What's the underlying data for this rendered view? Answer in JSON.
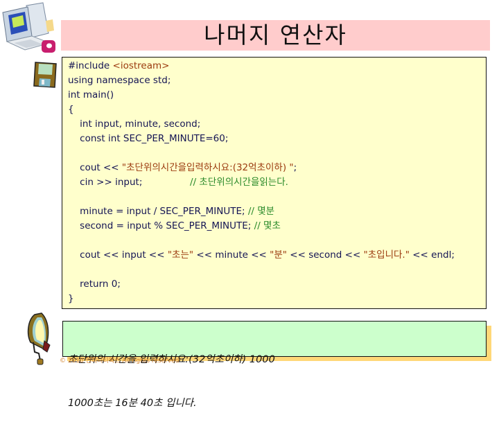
{
  "slide": {
    "title": "나머지 연산자",
    "icons": {
      "top_left": "computer-icon",
      "code_marker": "floppy-disk-icon",
      "output_marker": "monitor-lamp-icon"
    },
    "colors": {
      "title_bg": "#FFCCCC",
      "code_bg": "#FFFFCC",
      "output_bg": "#CCFFCC",
      "output_shadow": "#FFD878",
      "code_text": "#141454",
      "string_text": "#9b3a0f",
      "comment_text": "#2a8a2a"
    }
  },
  "code": {
    "lines": [
      {
        "parts": [
          {
            "t": "#include ",
            "k": "plain"
          },
          {
            "t": "<iostream>",
            "k": "inc"
          }
        ]
      },
      {
        "parts": [
          {
            "t": "using namespace std;",
            "k": "plain"
          }
        ]
      },
      {
        "parts": [
          {
            "t": "int main()",
            "k": "plain"
          }
        ]
      },
      {
        "parts": [
          {
            "t": "{",
            "k": "plain"
          }
        ]
      },
      {
        "parts": [
          {
            "t": "    int input, minute, second;",
            "k": "plain"
          }
        ]
      },
      {
        "parts": [
          {
            "t": "    const int SEC_PER_MINUTE=60;",
            "k": "plain"
          }
        ]
      },
      {
        "parts": []
      },
      {
        "parts": [
          {
            "t": "    cout << ",
            "k": "plain"
          },
          {
            "t": "\"초단위의시간을입력하시요:(32억초이하) \"",
            "k": "str"
          },
          {
            "t": ";",
            "k": "plain"
          }
        ]
      },
      {
        "parts": [
          {
            "t": "    cin >> input;                ",
            "k": "plain"
          },
          {
            "t": "// 초단위의시간을읽는다.",
            "k": "cmt"
          }
        ]
      },
      {
        "parts": []
      },
      {
        "parts": [
          {
            "t": "    minute = input / SEC_PER_MINUTE; ",
            "k": "plain"
          },
          {
            "t": "// 몇분",
            "k": "cmt"
          }
        ]
      },
      {
        "parts": [
          {
            "t": "    second = input % SEC_PER_MINUTE; ",
            "k": "plain"
          },
          {
            "t": "// 몇초",
            "k": "cmt"
          }
        ]
      },
      {
        "parts": []
      },
      {
        "parts": [
          {
            "t": "    cout << input << ",
            "k": "plain"
          },
          {
            "t": "\"초는\"",
            "k": "str"
          },
          {
            "t": " << minute << ",
            "k": "plain"
          },
          {
            "t": "\"분\"",
            "k": "str"
          },
          {
            "t": " << second << ",
            "k": "plain"
          },
          {
            "t": "\"초입니다.\"",
            "k": "str"
          },
          {
            "t": " << endl;",
            "k": "plain"
          }
        ]
      },
      {
        "parts": []
      },
      {
        "parts": [
          {
            "t": "    return 0;",
            "k": "plain"
          }
        ]
      },
      {
        "parts": [
          {
            "t": "}",
            "k": "plain"
          }
        ]
      }
    ]
  },
  "output": {
    "lines": [
      "초단위의 시간을 입력하시요:(32억초이하) 1000",
      "1000초는 16분 40초 입니다."
    ]
  },
  "footer": {
    "copyright": "© 2010 인피니티북스  All rights reserved"
  }
}
